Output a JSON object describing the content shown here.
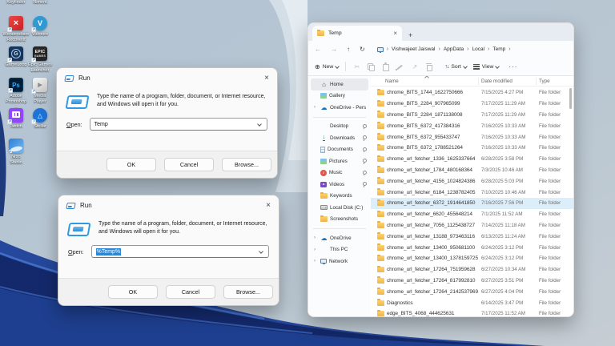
{
  "desktop": {
    "top_labels": [
      "Keyfinder",
      "Niment"
    ],
    "icons": [
      {
        "id": "recoverit",
        "type": "red-x",
        "glyph": "×",
        "col": 0,
        "row": 0,
        "label_lines": [
          "Wondershare",
          "Recoverit"
        ]
      },
      {
        "id": "vidmore",
        "type": "blue-v",
        "glyph": "V",
        "col": 1,
        "row": 0,
        "label_lines": [
          "Vidmore"
        ]
      },
      {
        "id": "gameloop",
        "type": "navy-g",
        "glyph": "G",
        "col": 0,
        "row": 1,
        "label_lines": [
          "GameLoop"
        ]
      },
      {
        "id": "epic-games",
        "type": "epic",
        "glyph": "EPIC",
        "glyph2": "GAMES",
        "col": 1,
        "row": 1,
        "label_lines": [
          "Epic Games",
          "Launcher"
        ]
      },
      {
        "id": "photoshop",
        "type": "ps",
        "glyph": "Ps",
        "col": 0,
        "row": 2,
        "label_lines": [
          "Adobe",
          "Photoshop ..."
        ]
      },
      {
        "id": "media-player",
        "type": "player",
        "glyph": "▶",
        "col": 1,
        "row": 2,
        "label_lines": [
          "Media Player"
        ]
      },
      {
        "id": "twitch",
        "type": "twitch",
        "glyph": "",
        "col": 0,
        "row": 3,
        "label_lines": [
          "Twitch"
        ]
      },
      {
        "id": "stellar",
        "type": "stellar",
        "glyph": "△",
        "col": 1,
        "row": 3,
        "label_lines": [
          "Stellar"
        ]
      },
      {
        "id": "studio",
        "type": "studio",
        "glyph": "",
        "col": 0,
        "row": 4,
        "label_lines": [
          "Nitro",
          "Studio"
        ]
      }
    ]
  },
  "run_dialogs": [
    {
      "title": "Run",
      "close_glyph": "×",
      "message": "Type the name of a program, folder, document, or Internet resource, and Windows will open it for you.",
      "open_label": "Open:",
      "value": "Temp",
      "selected": false,
      "ok_label": "OK",
      "cancel_label": "Cancel",
      "browse_label": "Browse..."
    },
    {
      "title": "Run",
      "close_glyph": "×",
      "message": "Type the name of a program, folder, document, or Internet resource, and Windows will open it for you.",
      "open_label": "Open:",
      "value": "%Temp%",
      "selected": true,
      "ok_label": "OK",
      "cancel_label": "Cancel",
      "browse_label": "Browse..."
    }
  ],
  "explorer": {
    "tab": {
      "label": "Temp",
      "close_glyph": "×",
      "new_tab_glyph": "+"
    },
    "nav_icons": [
      {
        "name": "back",
        "glyph": "←",
        "dim": true
      },
      {
        "name": "forward",
        "glyph": "→",
        "dim": true
      },
      {
        "name": "up",
        "glyph": "↑",
        "dim": false
      },
      {
        "name": "refresh",
        "glyph": "↻",
        "dim": false
      }
    ],
    "breadcrumb": {
      "separator": "›",
      "items": [
        "Vishwajeet Jaiswal",
        "AppData",
        "Local",
        "Temp"
      ]
    },
    "toolbar": {
      "new_label": "New",
      "new_glyph": "⊕",
      "sort_label": "Sort",
      "view_label": "View",
      "more_glyph": "···",
      "sort_glyph": "↑↓"
    },
    "toolbar_icons": [
      "cut",
      "copy",
      "paste",
      "rename",
      "share",
      "delete"
    ],
    "columns": [
      "Name",
      "Date modified",
      "Type"
    ],
    "sidebar": {
      "groups": [
        [
          {
            "slug": "home",
            "label": "Home",
            "icon": "home",
            "selected": true,
            "expandable": false,
            "pinned": false
          },
          {
            "slug": "gallery",
            "label": "Gallery",
            "icon": "pic",
            "selected": false,
            "expandable": false,
            "pinned": false
          },
          {
            "slug": "onedrive-persona",
            "label": "OneDrive - Persona",
            "icon": "cloud",
            "selected": false,
            "expandable": true,
            "pinned": false
          }
        ],
        [
          {
            "slug": "desktop",
            "label": "Desktop",
            "icon": "monitor",
            "selected": false,
            "expandable": false,
            "pinned": true
          },
          {
            "slug": "downloads",
            "label": "Downloads",
            "icon": "download",
            "selected": false,
            "expandable": false,
            "pinned": true
          },
          {
            "slug": "documents",
            "label": "Documents",
            "icon": "doc",
            "selected": false,
            "expandable": false,
            "pinned": true
          },
          {
            "slug": "pictures",
            "label": "Pictures",
            "icon": "pic",
            "selected": false,
            "expandable": false,
            "pinned": true
          },
          {
            "slug": "music",
            "label": "Music",
            "icon": "music",
            "selected": false,
            "expandable": false,
            "pinned": true
          },
          {
            "slug": "videos",
            "label": "Videos",
            "icon": "vid",
            "selected": false,
            "expandable": false,
            "pinned": true
          },
          {
            "slug": "keywords",
            "label": "Keywords",
            "icon": "folder",
            "selected": false,
            "expandable": false,
            "pinned": false
          },
          {
            "slug": "local-disk-c",
            "label": "Local Disk (C:)",
            "icon": "disk",
            "selected": false,
            "expandable": false,
            "pinned": false
          },
          {
            "slug": "screenshots",
            "label": "Screenshots",
            "icon": "folder",
            "selected": false,
            "expandable": false,
            "pinned": false
          }
        ],
        [
          {
            "slug": "onedrive",
            "label": "OneDrive",
            "icon": "cloud",
            "selected": false,
            "expandable": true,
            "pinned": false
          },
          {
            "slug": "this-pc",
            "label": "This PC",
            "icon": "monitor",
            "selected": false,
            "expandable": true,
            "pinned": false
          },
          {
            "slug": "network",
            "label": "Network",
            "icon": "net",
            "selected": false,
            "expandable": true,
            "pinned": false
          }
        ]
      ]
    },
    "rows": [
      {
        "name": "chrome_BITS_1744_1622750666",
        "date": "7/15/2025 4:27 PM",
        "type": "File folder",
        "highlighted": false
      },
      {
        "name": "chrome_BITS_2284_907965099",
        "date": "7/17/2025 11:29 AM",
        "type": "File folder",
        "highlighted": false
      },
      {
        "name": "chrome_BITS_2284_1871138008",
        "date": "7/17/2025 11:29 AM",
        "type": "File folder",
        "highlighted": false
      },
      {
        "name": "chrome_BITS_6372_417384316",
        "date": "7/16/2025 10:33 AM",
        "type": "File folder",
        "highlighted": false
      },
      {
        "name": "chrome_BITS_6372_955433747",
        "date": "7/16/2025 10:33 AM",
        "type": "File folder",
        "highlighted": false
      },
      {
        "name": "chrome_BITS_6372_1788521264",
        "date": "7/16/2025 10:33 AM",
        "type": "File folder",
        "highlighted": false
      },
      {
        "name": "chrome_url_fetcher_1336_1625337664",
        "date": "6/28/2025 3:58 PM",
        "type": "File folder",
        "highlighted": false
      },
      {
        "name": "chrome_url_fetcher_1784_480168364",
        "date": "7/3/2025 10:46 AM",
        "type": "File folder",
        "highlighted": false
      },
      {
        "name": "chrome_url_fetcher_4156_1024824386",
        "date": "6/28/2025 5:03 PM",
        "type": "File folder",
        "highlighted": false
      },
      {
        "name": "chrome_url_fetcher_6184_1238782405",
        "date": "7/10/2025 10:46 AM",
        "type": "File folder",
        "highlighted": false
      },
      {
        "name": "chrome_url_fetcher_6372_1914641850",
        "date": "7/16/2025 7:56 PM",
        "type": "File folder",
        "highlighted": true
      },
      {
        "name": "chrome_url_fetcher_6620_455648214",
        "date": "7/1/2025 11:52 AM",
        "type": "File folder",
        "highlighted": false
      },
      {
        "name": "chrome_url_fetcher_7056_1125438727",
        "date": "7/14/2025 11:18 AM",
        "type": "File folder",
        "highlighted": false
      },
      {
        "name": "chrome_url_fetcher_13188_973463116",
        "date": "6/13/2025 11:24 AM",
        "type": "File folder",
        "highlighted": false
      },
      {
        "name": "chrome_url_fetcher_13400_950681100",
        "date": "6/24/2025 3:12 PM",
        "type": "File folder",
        "highlighted": false
      },
      {
        "name": "chrome_url_fetcher_13400_1378159725",
        "date": "6/24/2025 3:12 PM",
        "type": "File folder",
        "highlighted": false
      },
      {
        "name": "chrome_url_fetcher_17264_751959628",
        "date": "6/27/2025 10:34 AM",
        "type": "File folder",
        "highlighted": false
      },
      {
        "name": "chrome_url_fetcher_17264_817992810",
        "date": "6/27/2025 3:51 PM",
        "type": "File folder",
        "highlighted": false
      },
      {
        "name": "chrome_url_fetcher_17264_2142537969",
        "date": "6/27/2025 4:04 PM",
        "type": "File folder",
        "highlighted": false
      },
      {
        "name": "Diagnostics",
        "date": "6/14/2025 3:47 PM",
        "type": "File folder",
        "highlighted": false
      },
      {
        "name": "edge_BITS_4068_444625631",
        "date": "7/17/2025 11:52 AM",
        "type": "File folder",
        "highlighted": false
      }
    ]
  },
  "colors": {
    "accent": "#2f86d3",
    "selection": "#2f86d3",
    "highlight_row": "#ddeefb",
    "wallpaper_dark": "#16307c"
  }
}
